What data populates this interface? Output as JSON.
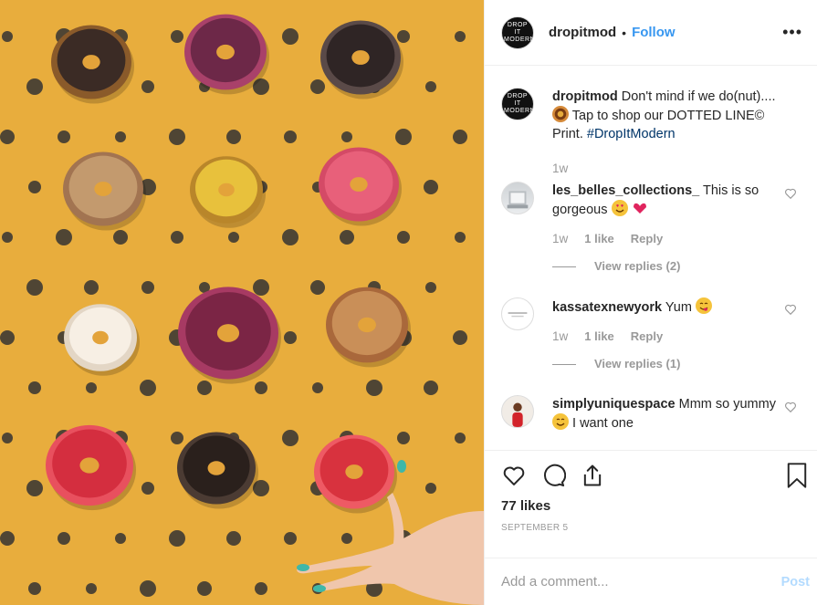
{
  "post": {
    "author": "dropitmod",
    "follow_label": "Follow",
    "separator": "•",
    "more_label": "•••",
    "avatar_text": "DROP IT MODERN"
  },
  "caption": {
    "user": "dropitmod",
    "text_before": "Don't mind if we do(nut).... ",
    "text_after": " Tap to shop our DOTTED LINE© Print. ",
    "hashtag": "#DropItModern",
    "age": "1w"
  },
  "comments": [
    {
      "user": "les_belles_collections_",
      "text": "This is so gorgeous",
      "age": "1w",
      "likes": "1 like",
      "reply": "Reply",
      "view_replies": "View replies (2)"
    },
    {
      "user": "kassatexnewyork",
      "text": "Yum",
      "age": "1w",
      "likes": "1 like",
      "reply": "Reply",
      "view_replies": "View replies (1)"
    },
    {
      "user": "simplyuniquespace",
      "text_before": "Mmm so yummy ",
      "text_after": " I want one"
    }
  ],
  "stats": {
    "likes": "77 likes",
    "date": "SEPTEMBER 5"
  },
  "add_comment": {
    "placeholder": "Add a comment...",
    "post_label": "Post"
  },
  "colors": {
    "accent": "#3897f0",
    "hashtag": "#003569",
    "post_disabled": "#b3dbff",
    "photo_background": "#e7ac3c"
  },
  "icons": [
    "heart-icon",
    "comment-icon",
    "share-icon",
    "bookmark-icon",
    "more-icon"
  ]
}
